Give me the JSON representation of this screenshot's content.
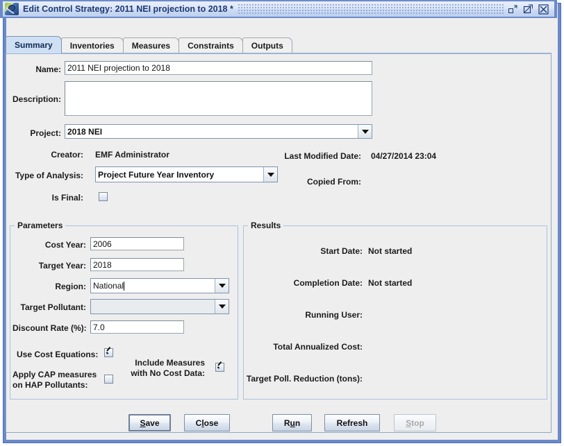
{
  "window": {
    "title": "Edit Control Strategy: 2011 NEI projection to 2018 *",
    "icon": "app-satellite-icon",
    "controls": {
      "minimize": "minimize-icon",
      "maximize": "maximize-icon",
      "close": "close-icon"
    }
  },
  "tabs": [
    {
      "label": "Summary",
      "active": true
    },
    {
      "label": "Inventories",
      "active": false
    },
    {
      "label": "Measures",
      "active": false
    },
    {
      "label": "Constraints",
      "active": false
    },
    {
      "label": "Outputs",
      "active": false
    }
  ],
  "summary": {
    "name_label": "Name:",
    "name_value": "2011 NEI projection to 2018",
    "description_label": "Description:",
    "description_value": "",
    "project_label": "Project:",
    "project_value": "2018 NEI",
    "creator_label": "Creator:",
    "creator_value": "EMF Administrator",
    "last_modified_label": "Last Modified Date:",
    "last_modified_value": "04/27/2014 23:04",
    "type_of_analysis_label": "Type of Analysis:",
    "type_of_analysis_value": "Project Future Year Inventory",
    "copied_from_label": "Copied From:",
    "copied_from_value": "",
    "is_final_label": "Is Final:",
    "is_final_checked": false
  },
  "parameters": {
    "title": "Parameters",
    "cost_year_label": "Cost Year:",
    "cost_year_value": "2006",
    "target_year_label": "Target Year:",
    "target_year_value": "2018",
    "region_label": "Region:",
    "region_value": "National",
    "target_pollutant_label": "Target Pollutant:",
    "target_pollutant_value": "",
    "discount_rate_label": "Discount Rate (%):",
    "discount_rate_value": "7.0",
    "use_cost_equations_label": "Use Cost Equations:",
    "use_cost_equations_checked": true,
    "apply_cap_label_line1": "Apply CAP measures",
    "apply_cap_label_line2": "on HAP Pollutants:",
    "apply_cap_checked": false,
    "include_measures_label_line1": "Include Measures",
    "include_measures_label_line2": "with No Cost Data:",
    "include_measures_checked": true
  },
  "results": {
    "title": "Results",
    "start_date_label": "Start Date:",
    "start_date_value": "Not started",
    "completion_date_label": "Completion Date:",
    "completion_date_value": "Not started",
    "running_user_label": "Running User:",
    "running_user_value": "",
    "total_annualized_cost_label": "Total Annualized Cost:",
    "total_annualized_cost_value": "",
    "target_poll_reduction_label": "Target Poll. Reduction (tons):",
    "target_poll_reduction_value": ""
  },
  "buttons": {
    "save": {
      "pre": "",
      "mnemonic": "S",
      "post": "ave"
    },
    "close": {
      "pre": "C",
      "mnemonic": "l",
      "post": "ose"
    },
    "run": {
      "pre": "R",
      "mnemonic": "u",
      "post": "n"
    },
    "refresh": {
      "pre": "Refresh",
      "mnemonic": "",
      "post": ""
    },
    "stop": {
      "pre": "",
      "mnemonic": "S",
      "post": "top",
      "disabled": true
    }
  },
  "colors": {
    "titlebar_text": "#1d3a73",
    "titlebar_border": "#6b8ac9",
    "panel_bg": "#eeeeee",
    "active_tab_bg": "#cfe0f4",
    "group_border": "#aac2de"
  }
}
